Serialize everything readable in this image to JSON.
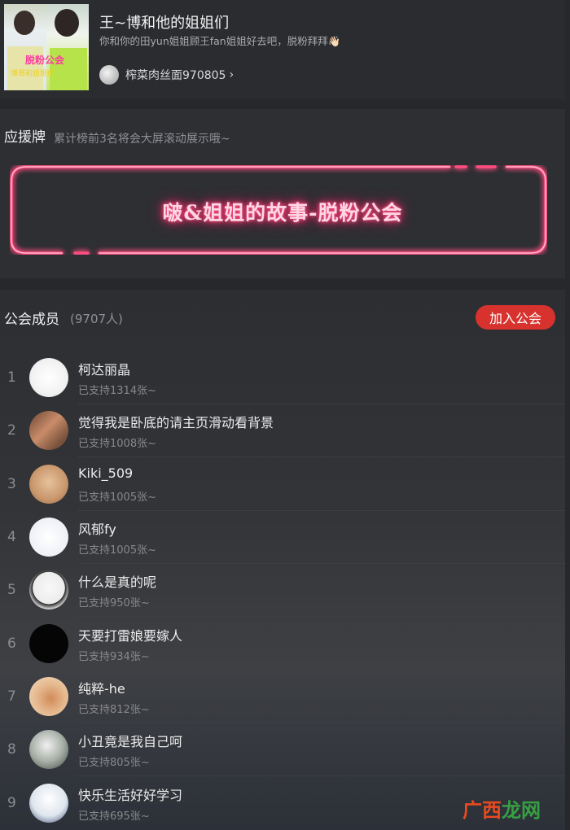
{
  "header": {
    "title": "王~博和他的姐姐们",
    "description": "你和你的田yun姐姐顾王fan姐姐好去吧，脱粉拜拜👋🏻",
    "author": "榨菜肉丝面970805",
    "cover_text": "脱粉公会",
    "cover_text2": "博哥和姐姐们"
  },
  "badge": {
    "title": "应援牌",
    "note": "累计榜前3名将会大屏滚动展示哦~",
    "neon_text": "啵&姐姐的故事-脱粉公会",
    "neon_color": "#ff3d74"
  },
  "members": {
    "title": "公会成员",
    "count": "(9707人)",
    "join_label": "加入公会",
    "join_color": "#d8322e",
    "list": [
      {
        "rank": "1",
        "name": "柯达丽晶",
        "support": "已支持1314张~"
      },
      {
        "rank": "2",
        "name": "觉得我是卧底的请主页滑动看背景",
        "support": "已支持1008张~"
      },
      {
        "rank": "3",
        "name": "Kiki_509",
        "support": "已支持1005张~"
      },
      {
        "rank": "4",
        "name": "风郁fy",
        "support": "已支持1005张~"
      },
      {
        "rank": "5",
        "name": "什么是真的呢",
        "support": "已支持950张~"
      },
      {
        "rank": "6",
        "name": "天要打雷娘要嫁人",
        "support": "已支持934张~"
      },
      {
        "rank": "7",
        "name": "纯粹-he",
        "support": "已支持812张~"
      },
      {
        "rank": "8",
        "name": "小丑竟是我自己呵",
        "support": "已支持805张~"
      },
      {
        "rank": "9",
        "name": "快乐生活好好学习",
        "support": "已支持695张~"
      }
    ]
  },
  "watermark": {
    "part1": "广西",
    "part2": "龙网"
  }
}
